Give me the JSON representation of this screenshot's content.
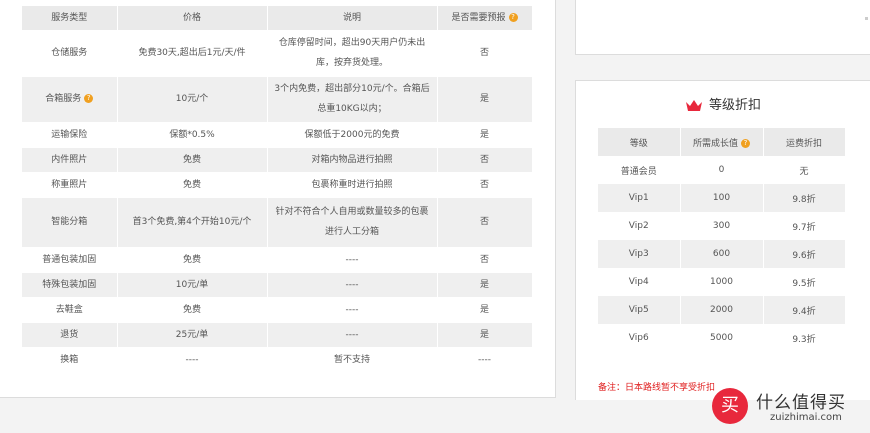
{
  "services": {
    "headers": [
      "服务类型",
      "价格",
      "说明",
      "是否需要预报"
    ],
    "rows": [
      {
        "type": "仓储服务",
        "price": "免费30天,超出后1元/天/件",
        "desc": [
          "仓库停留时间，超出90天用户仍未出",
          "库，按弃货处理。"
        ],
        "forecast": "否"
      },
      {
        "type": "合箱服务",
        "price": "10元/个",
        "desc": [
          "3个内免费，超出部分10元/个。合箱后",
          "总重10KG以内；"
        ],
        "forecast": "是"
      },
      {
        "type": "运输保险",
        "price": "保额*0.5%",
        "desc": [
          "保额低于2000元的免费"
        ],
        "forecast": "是"
      },
      {
        "type": "内件照片",
        "price": "免费",
        "desc": [
          "对箱内物品进行拍照"
        ],
        "forecast": "否"
      },
      {
        "type": "称重照片",
        "price": "免费",
        "desc": [
          "包裹称重时进行拍照"
        ],
        "forecast": "否"
      },
      {
        "type": "智能分箱",
        "price": "首3个免费,第4个开始10元/个",
        "desc": [
          "针对不符合个人自用或数量较多的包裹",
          "进行人工分箱"
        ],
        "forecast": "否"
      },
      {
        "type": "普通包装加固",
        "price": "免费",
        "desc": [
          "----"
        ],
        "forecast": "否"
      },
      {
        "type": "特殊包装加固",
        "price": "10元/单",
        "desc": [
          "----"
        ],
        "forecast": "是"
      },
      {
        "type": "去鞋盒",
        "price": "免费",
        "desc": [
          "----"
        ],
        "forecast": "是"
      },
      {
        "type": "退货",
        "price": "25元/单",
        "desc": [
          "----"
        ],
        "forecast": "是"
      },
      {
        "type": "换箱",
        "price": "----",
        "desc": [
          "暂不支持"
        ],
        "forecast": "----"
      }
    ]
  },
  "levels": {
    "title": "等级折扣",
    "headers": [
      "等级",
      "所需成长值",
      "运费折扣"
    ],
    "rows": [
      {
        "level": "普通会员",
        "growth": "0",
        "discount": "无"
      },
      {
        "level": "Vip1",
        "growth": "100",
        "discount": "9.8折"
      },
      {
        "level": "Vip2",
        "growth": "300",
        "discount": "9.7折"
      },
      {
        "level": "Vip3",
        "growth": "600",
        "discount": "9.6折"
      },
      {
        "level": "Vip4",
        "growth": "1000",
        "discount": "9.5折"
      },
      {
        "level": "Vip5",
        "growth": "2000",
        "discount": "9.4折"
      },
      {
        "level": "Vip6",
        "growth": "5000",
        "discount": "9.3折"
      }
    ],
    "note": "备注：日本路线暂不享受折扣"
  },
  "watermark": {
    "logo": "买",
    "cn": "什么值得买",
    "en": "zuizhimai.com"
  },
  "colors": {
    "accent": "#e02020",
    "help_icon": "#f0a020",
    "header_bg": "#eaeaea",
    "row_alt": "#efefef"
  }
}
